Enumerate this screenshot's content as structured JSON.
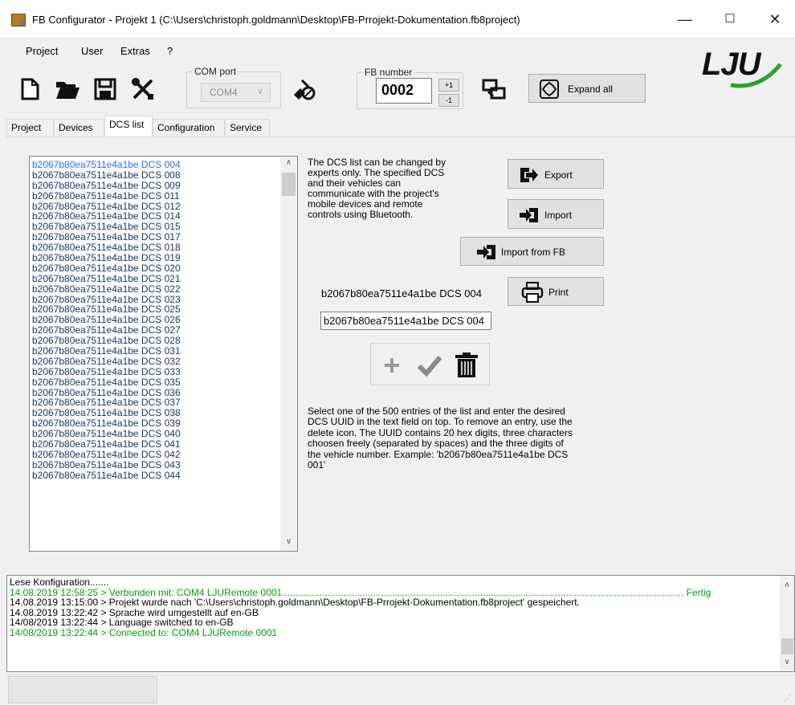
{
  "window": {
    "title": "FB Configurator - Projekt 1 (C:\\Users\\christoph.goldmann\\Desktop\\FB-Prrojekt-Dokumentation.fb8project)",
    "minimize": "—",
    "maximize": "☐",
    "close": "✕"
  },
  "menu": [
    "Project",
    "User",
    "Extras",
    "?"
  ],
  "toolbar": {
    "com_port_label": "COM port",
    "com_port_value": "COM4",
    "fb_number_label": "FB number",
    "fb_number_value": "0002",
    "inc_label": "+1",
    "dec_label": "-1",
    "expand_label": "Expand all"
  },
  "logo": "LJU",
  "tabs": [
    "Project",
    "Devices",
    "DCS list",
    "Configuration",
    "Service"
  ],
  "active_tab": "DCS list",
  "dcs_list": [
    "b2067b80ea7511e4a1be DCS 004",
    "b2067b80ea7511e4a1be DCS 008",
    "b2067b80ea7511e4a1be DCS 009",
    "b2067b80ea7511e4a1be DCS 011",
    "b2067b80ea7511e4a1be DCS 012",
    "b2067b80ea7511e4a1be DCS 014",
    "b2067b80ea7511e4a1be DCS 015",
    "b2067b80ea7511e4a1be DCS 017",
    "b2067b80ea7511e4a1be DCS 018",
    "b2067b80ea7511e4a1be DCS 019",
    "b2067b80ea7511e4a1be DCS 020",
    "b2067b80ea7511e4a1be DCS 021",
    "b2067b80ea7511e4a1be DCS 022",
    "b2067b80ea7511e4a1be DCS 023",
    "b2067b80ea7511e4a1be DCS 025",
    "b2067b80ea7511e4a1be DCS 026",
    "b2067b80ea7511e4a1be DCS 027",
    "b2067b80ea7511e4a1be DCS 028",
    "b2067b80ea7511e4a1be DCS 031",
    "b2067b80ea7511e4a1be DCS 032",
    "b2067b80ea7511e4a1be DCS 033",
    "b2067b80ea7511e4a1be DCS 035",
    "b2067b80ea7511e4a1be DCS 036",
    "b2067b80ea7511e4a1be DCS 037",
    "b2067b80ea7511e4a1be DCS 038",
    "b2067b80ea7511e4a1be DCS 039",
    "b2067b80ea7511e4a1be DCS 040",
    "b2067b80ea7511e4a1be DCS 041",
    "b2067b80ea7511e4a1be DCS 042",
    "b2067b80ea7511e4a1be DCS 043",
    "b2067b80ea7511e4a1be DCS 044"
  ],
  "info_text": "The DCS list can be changed by experts only. The specified DCS and their vehicles can communicate with the project's mobile devices and remote controls using Bluetooth.",
  "buttons": {
    "export": "Export",
    "import": "Import",
    "import_from_fb": "Import from FB",
    "print": "Print"
  },
  "selected_entry": "b2067b80ea7511e4a1be DCS 004",
  "uuid_input_value": "b2067b80ea7511e4a1be DCS 004",
  "help_text": "Select one of the 500 entries of the list and enter the desired DCS UUID in the text field on top. To remove an entry, use the delete icon. The UUID contains 20 hex digits, three characters choosen freely (separated by spaces) and the three digits of the vehicle number. Example: 'b2067b80ea7511e4a1be DCS 001'",
  "log": [
    {
      "text": "Lese Konfiguration.......",
      "color": "#000000"
    },
    {
      "text": "14.08.2019 12:58:25 > Verbunden mit: COM4 LJURemote 0001...................................................................................................................................................... Fertig",
      "color": "#0a9b0a"
    },
    {
      "text": "14.08.2019 13:15:00 > Projekt wurde nach 'C:\\Users\\christoph.goldmann\\Desktop\\FB-Prrojekt-Dokumentation.fb8project' gespeichert.",
      "color": "#000000"
    },
    {
      "text": "14.08.2019 13:22:42 > Sprache wird umgestellt auf en-GB",
      "color": "#000000"
    },
    {
      "text": "14/08/2019 13:22:44 > Language switched to en-GB",
      "color": "#000000"
    },
    {
      "text": "14/08/2019 13:22:44 > Connected to: COM4 LJURemote 0001",
      "color": "#0a9b0a"
    }
  ]
}
